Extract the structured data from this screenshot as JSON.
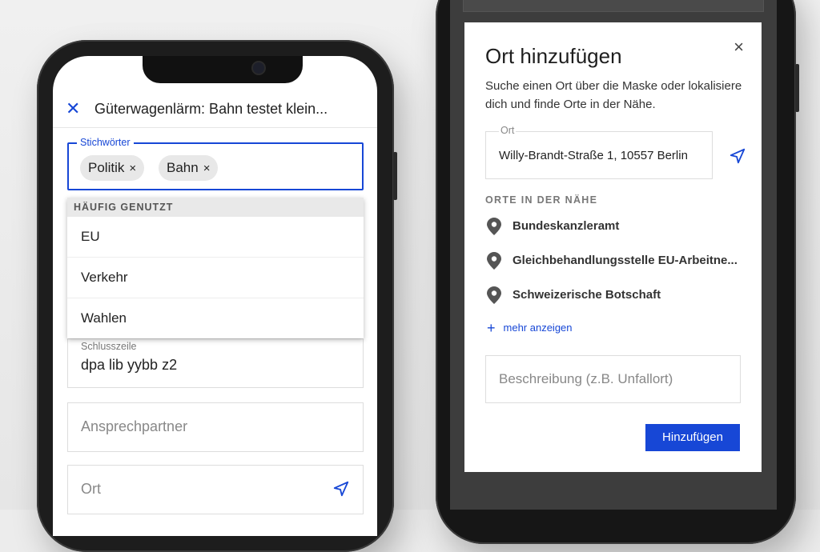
{
  "left_screen": {
    "header": {
      "close_icon": "close-icon",
      "title": "Güterwagenlärm: Bahn testet klein..."
    },
    "keywords": {
      "label": "Stichwörter",
      "chips": [
        {
          "label": "Politik",
          "remove": "×"
        },
        {
          "label": "Bahn",
          "remove": "×"
        }
      ]
    },
    "dropdown": {
      "heading": "HÄUFIG GENUTZT",
      "items": [
        "EU",
        "Verkehr",
        "Wahlen"
      ]
    },
    "fields": {
      "schlusszeile": {
        "label": "Schlusszeile",
        "value": "dpa lib yybb z2"
      },
      "ansprechpartner": {
        "placeholder": "Ansprechpartner"
      },
      "ort": {
        "placeholder": "Ort",
        "icon": "location-arrow-icon"
      }
    }
  },
  "dialog": {
    "title": "Ort hinzufügen",
    "close": "×",
    "description": "Suche einen Ort über die Maske oder lokalisiere dich und finde Orte in der Nähe.",
    "ort_field": {
      "label": "Ort",
      "value": "Willy-Brandt-Straße 1, 10557 Berlin"
    },
    "nearby": {
      "heading": "ORTE IN DER NÄHE",
      "places": [
        "Bundeskanzleramt",
        "Gleichbehandlungsstelle EU-Arbeitne...",
        "Schweizerische Botschaft"
      ]
    },
    "more": {
      "plus": "+",
      "label": "mehr anzeigen"
    },
    "beschreibung": {
      "placeholder": "Beschreibung (z.B. Unfallort)"
    },
    "submit": "Hinzufügen"
  },
  "colors": {
    "accent": "#1747d6",
    "dark_frame": "#1d1d1d",
    "chip_bg": "#e8e8e8"
  }
}
